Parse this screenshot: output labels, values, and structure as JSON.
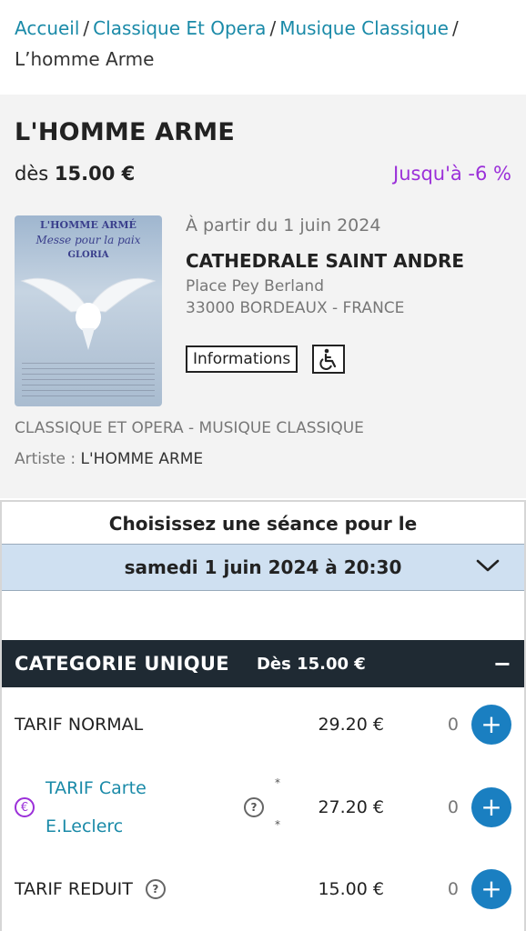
{
  "breadcrumb": {
    "items": [
      "Accueil",
      "Classique Et Opera",
      "Musique Classique"
    ],
    "separator": "/",
    "current": "L’homme Arme"
  },
  "event": {
    "title": "L'HOMME ARME",
    "price_prefix": "dès",
    "price": "15.00 €",
    "discount": "Jusqu'à -6 %",
    "poster": {
      "title": "L'HOMME ARMÉ",
      "subtitle": "Messe pour la paix",
      "line3": "GLORIA"
    },
    "date_text": "À partir du 1 juin 2024",
    "venue_name": "CATHEDRALE SAINT ANDRE",
    "address_line1": "Place Pey Berland",
    "address_line2": "33000 BORDEAUX - FRANCE",
    "info_button": "Informations",
    "accessibility_icon": "wheelchair-icon",
    "categories": "CLASSIQUE ET OPERA  - MUSIQUE CLASSIQUE",
    "artist_label": "Artiste :",
    "artist_value": "L'HOMME ARME"
  },
  "booking": {
    "choose_text": "Choisissez une séance pour le",
    "session": "samedi 1 juin 2024 à 20:30",
    "category": {
      "name": "CATEGORIE UNIQUE",
      "from_price": "Dès 15.00 €",
      "collapse": "−"
    },
    "tariffs": [
      {
        "label": "TARIF NORMAL",
        "price": "29.20 €",
        "qty": "0"
      },
      {
        "label_line1": "TARIF Carte",
        "label_line2": "E.Leclerc",
        "price": "27.20 €",
        "qty": "0",
        "star": "*"
      },
      {
        "label": "TARIF REDUIT",
        "price": "15.00 €",
        "qty": "0"
      }
    ],
    "plus": "+"
  },
  "colors": {
    "link": "#1a8aa8",
    "discount": "#9b30d9",
    "header_bg": "#1f2a33",
    "plus_bg": "#1a7fc1",
    "session_bg": "#cfe0f1"
  }
}
